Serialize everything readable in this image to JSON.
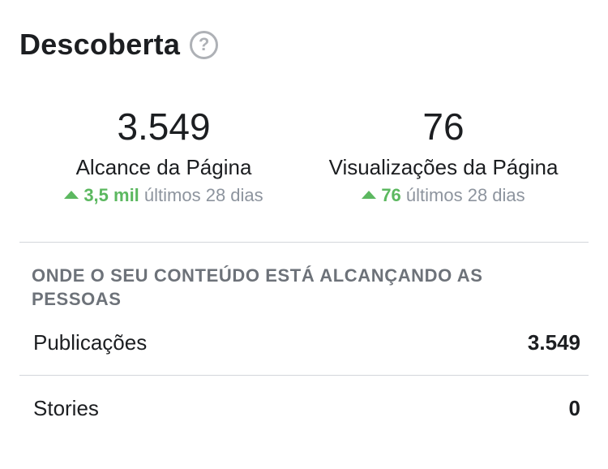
{
  "header": {
    "title": "Descoberta",
    "help_glyph": "?"
  },
  "metrics": [
    {
      "value": "3.549",
      "label": "Alcance da Página",
      "trend_value": "3,5 mil",
      "trend_period": "últimos 28 dias"
    },
    {
      "value": "76",
      "label": "Visualizações da Página",
      "trend_value": "76",
      "trend_period": "últimos 28 dias"
    }
  ],
  "section": {
    "heading": "ONDE O SEU CONTEÚDO ESTÁ ALCANÇANDO AS PESSOAS",
    "rows": [
      {
        "label": "Publicações",
        "value": "3.549"
      },
      {
        "label": "Stories",
        "value": "0"
      }
    ]
  },
  "colors": {
    "trend_up": "#5cb860",
    "muted": "#8d949e",
    "heading": "#6d7279",
    "divider": "#d3d6db"
  }
}
